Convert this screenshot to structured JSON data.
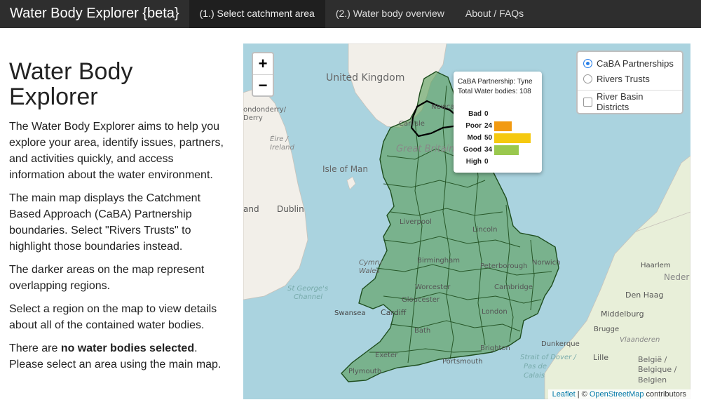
{
  "navbar": {
    "brand": "Water Body Explorer {beta}",
    "tabs": [
      {
        "label": "(1.) Select catchment area",
        "active": true
      },
      {
        "label": "(2.) Water body overview",
        "active": false
      },
      {
        "label": "About / FAQs",
        "active": false
      }
    ]
  },
  "sidebar": {
    "title": "Water Body Explorer",
    "para1": "The Water Body Explorer aims to help you explore your area, identify issues, partners, and activities quickly, and access information about the water environment.",
    "para2": "The main map displays the Catchment Based Approach (CaBA) Partnership boundaries. Select \"Rivers Trusts\" to highlight those boundaries instead.",
    "para3": "The darker areas on the map represent overlapping regions.",
    "para4": "Select a region on the map to view details about all of the contained water bodies.",
    "para5_pre": "There are ",
    "para5_bold": "no water bodies selected",
    "para5_post": ". Please select an area using the main map."
  },
  "map": {
    "zoom_in": "+",
    "zoom_out": "−",
    "layers": {
      "option1": "CaBA Partnerships",
      "option2": "Rivers Trusts",
      "overlay": "River Basin Districts",
      "selected": "CaBA Partnerships"
    },
    "popup": {
      "partnership": "CaBA Partnership: Tyne",
      "total": "Total Water bodies: 108",
      "bars": [
        {
          "label": "Bad",
          "value": 0,
          "color": "#e8561c"
        },
        {
          "label": "Poor",
          "value": 24,
          "color": "#f29a11"
        },
        {
          "label": "Mod",
          "value": 50,
          "color": "#f5c90f"
        },
        {
          "label": "Good",
          "value": 34,
          "color": "#9ac84e"
        },
        {
          "label": "High",
          "value": 0,
          "color": "#3b82c4"
        }
      ]
    },
    "labels": {
      "uk": "United Kingdom",
      "gb": "Great Britain",
      "iom": "Isle of Man",
      "dublin": "Dublin",
      "ireland": "Ireland",
      "eire": "Éire /",
      "londonderry": "ondonderry/",
      "derry": "Derry",
      "land": "and",
      "carlisle": "Carlisle",
      "newcastle": "Newcas",
      "liverpool": "Liverpool",
      "lincoln": "Lincoln",
      "birmingham": "Birmingham",
      "peterborough": "Peterborough",
      "norwich": "Norwich",
      "worcester": "Worcester",
      "cambridge": "Cambridge",
      "gloucester": "Gloucester",
      "london": "London",
      "cardiff": "Cardiff",
      "swansea": "Swansea",
      "bath": "Bath",
      "brighton": "Brighton",
      "exeter": "Exeter",
      "portsmouth": "Portsmouth",
      "plymouth": "Plymouth",
      "cymru": "Cymru",
      "wales": "Wales",
      "stgeorge": "St George's",
      "channel": "Channel",
      "dover": "Strait of Dover /",
      "pasde": "Pas de",
      "calais": "Calais",
      "dunkerque": "Dunkerque",
      "lille": "Lille",
      "brugge": "Brugge",
      "vlaanderen": "Vlaanderen",
      "middelburg": "Middelburg",
      "denhaag": "Den Haag",
      "haarlem": "Haarlem",
      "neder": "Neder",
      "belgie": "België /",
      "belgique": "Belgique /",
      "belgien": "Belgien"
    },
    "attribution": {
      "leaflet": "Leaflet",
      "sep": " | © ",
      "osm": "OpenStreetMap",
      "contrib": " contributors"
    }
  }
}
